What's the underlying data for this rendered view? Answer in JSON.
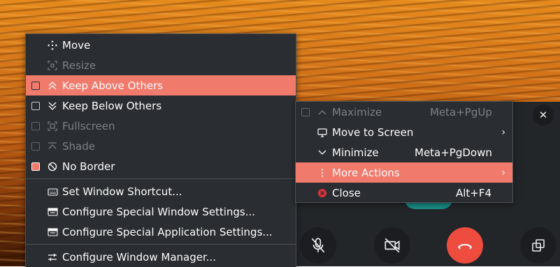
{
  "main_menu": {
    "move": "Move",
    "resize": "Resize",
    "keep_above": "Keep Above Others",
    "keep_below": "Keep Below Others",
    "fullscreen": "Fullscreen",
    "shade": "Shade",
    "no_border": "No Border",
    "set_shortcut": "Set Window Shortcut...",
    "special_window": "Configure Special Window Settings...",
    "special_app": "Configure Special Application Settings...",
    "window_manager": "Configure Window Manager..."
  },
  "sub_menu": {
    "maximize": "Maximize",
    "maximize_shortcut": "Meta+PgUp",
    "move_to_screen": "Move to Screen",
    "minimize": "Minimize",
    "minimize_shortcut": "Meta+PgDown",
    "more_actions": "More Actions",
    "close": "Close",
    "close_shortcut": "Alt+F4"
  },
  "call_window": {
    "close_glyph": "✕"
  },
  "colors": {
    "highlight": "#f07a6c",
    "menu_bg": "#2a2e32",
    "hangup_red": "#ed4c3f"
  }
}
